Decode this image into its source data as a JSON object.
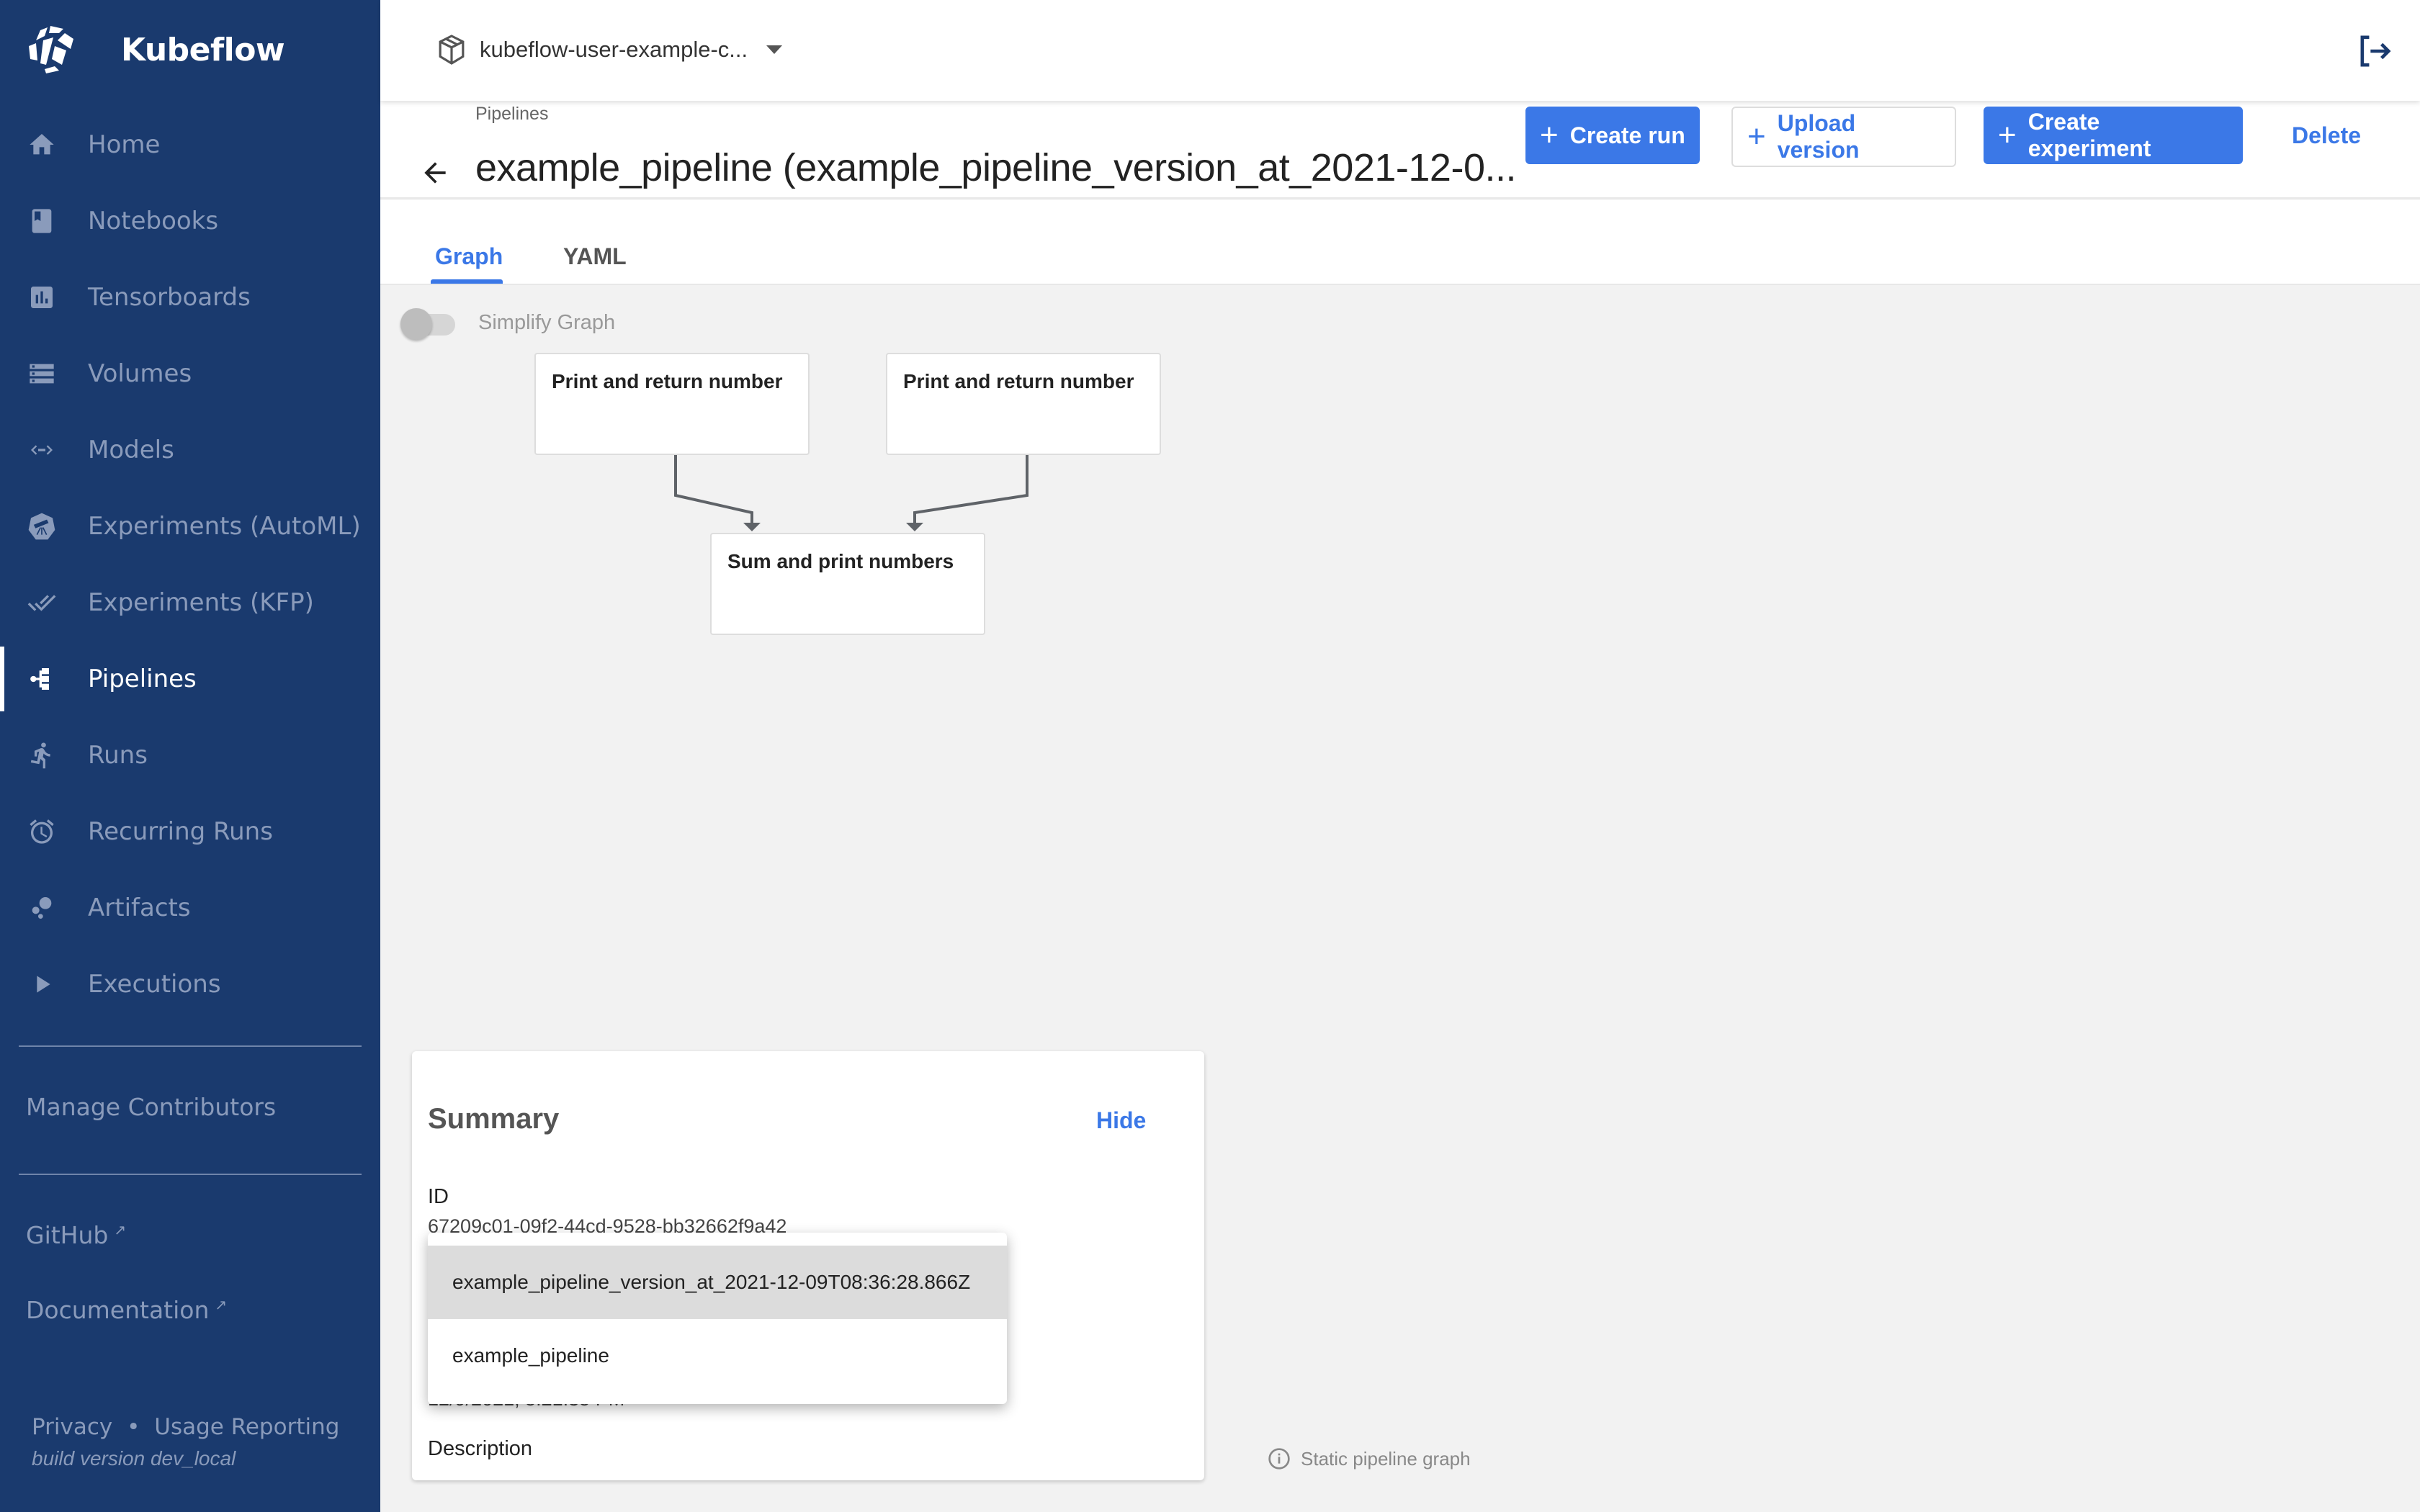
{
  "app": {
    "name": "Kubeflow",
    "brand_color": "#1a3a6e",
    "accent_color": "#3b78e7"
  },
  "sidebar": {
    "items": [
      {
        "label": "Home",
        "icon": "home-icon"
      },
      {
        "label": "Notebooks",
        "icon": "notebook-icon"
      },
      {
        "label": "Tensorboards",
        "icon": "bar-chart-icon"
      },
      {
        "label": "Volumes",
        "icon": "storage-icon"
      },
      {
        "label": "Models",
        "icon": "code-arrows-icon"
      },
      {
        "label": "Experiments (AutoML)",
        "icon": "telescope-icon"
      },
      {
        "label": "Experiments (KFP)",
        "icon": "done-all-icon"
      },
      {
        "label": "Pipelines",
        "icon": "pipeline-icon",
        "active": true
      },
      {
        "label": "Runs",
        "icon": "run-icon"
      },
      {
        "label": "Recurring Runs",
        "icon": "alarm-icon"
      },
      {
        "label": "Artifacts",
        "icon": "bubbles-icon"
      },
      {
        "label": "Executions",
        "icon": "play-icon"
      }
    ],
    "manage_contributors": "Manage Contributors",
    "github": "GitHub",
    "documentation": "Documentation",
    "privacy": "Privacy",
    "separator": "•",
    "usage_reporting": "Usage Reporting",
    "build_version": "build version dev_local"
  },
  "topbar": {
    "namespace": "kubeflow-user-example-c..."
  },
  "header": {
    "breadcrumb": "Pipelines",
    "title": "example_pipeline (example_pipeline_version_at_2021-12-0...",
    "buttons": {
      "create_run": "Create run",
      "upload_version": "Upload version",
      "create_experiment": "Create experiment",
      "delete": "Delete"
    }
  },
  "tabs": [
    {
      "label": "Graph",
      "active": true
    },
    {
      "label": "YAML",
      "active": false
    }
  ],
  "graph": {
    "simplify_label": "Simplify Graph",
    "simplify_on": false,
    "nodes": [
      {
        "label": "Print and return number"
      },
      {
        "label": "Print and return number"
      },
      {
        "label": "Sum and print numbers"
      }
    ],
    "edges": [
      {
        "from": 0,
        "to": 2
      },
      {
        "from": 1,
        "to": 2
      }
    ],
    "info": "Static pipeline graph"
  },
  "summary": {
    "title": "Summary",
    "hide": "Hide",
    "id_label": "ID",
    "id_value": "67209c01-09f2-44cd-9528-bb32662f9a42",
    "uploaded_value": "12/9/2021, 5:21:35 PM",
    "description_label": "Description"
  },
  "version_dropdown": {
    "options": [
      {
        "label": "example_pipeline_version_at_2021-12-09T08:36:28.866Z",
        "selected": true
      },
      {
        "label": "example_pipeline",
        "selected": false
      }
    ]
  }
}
